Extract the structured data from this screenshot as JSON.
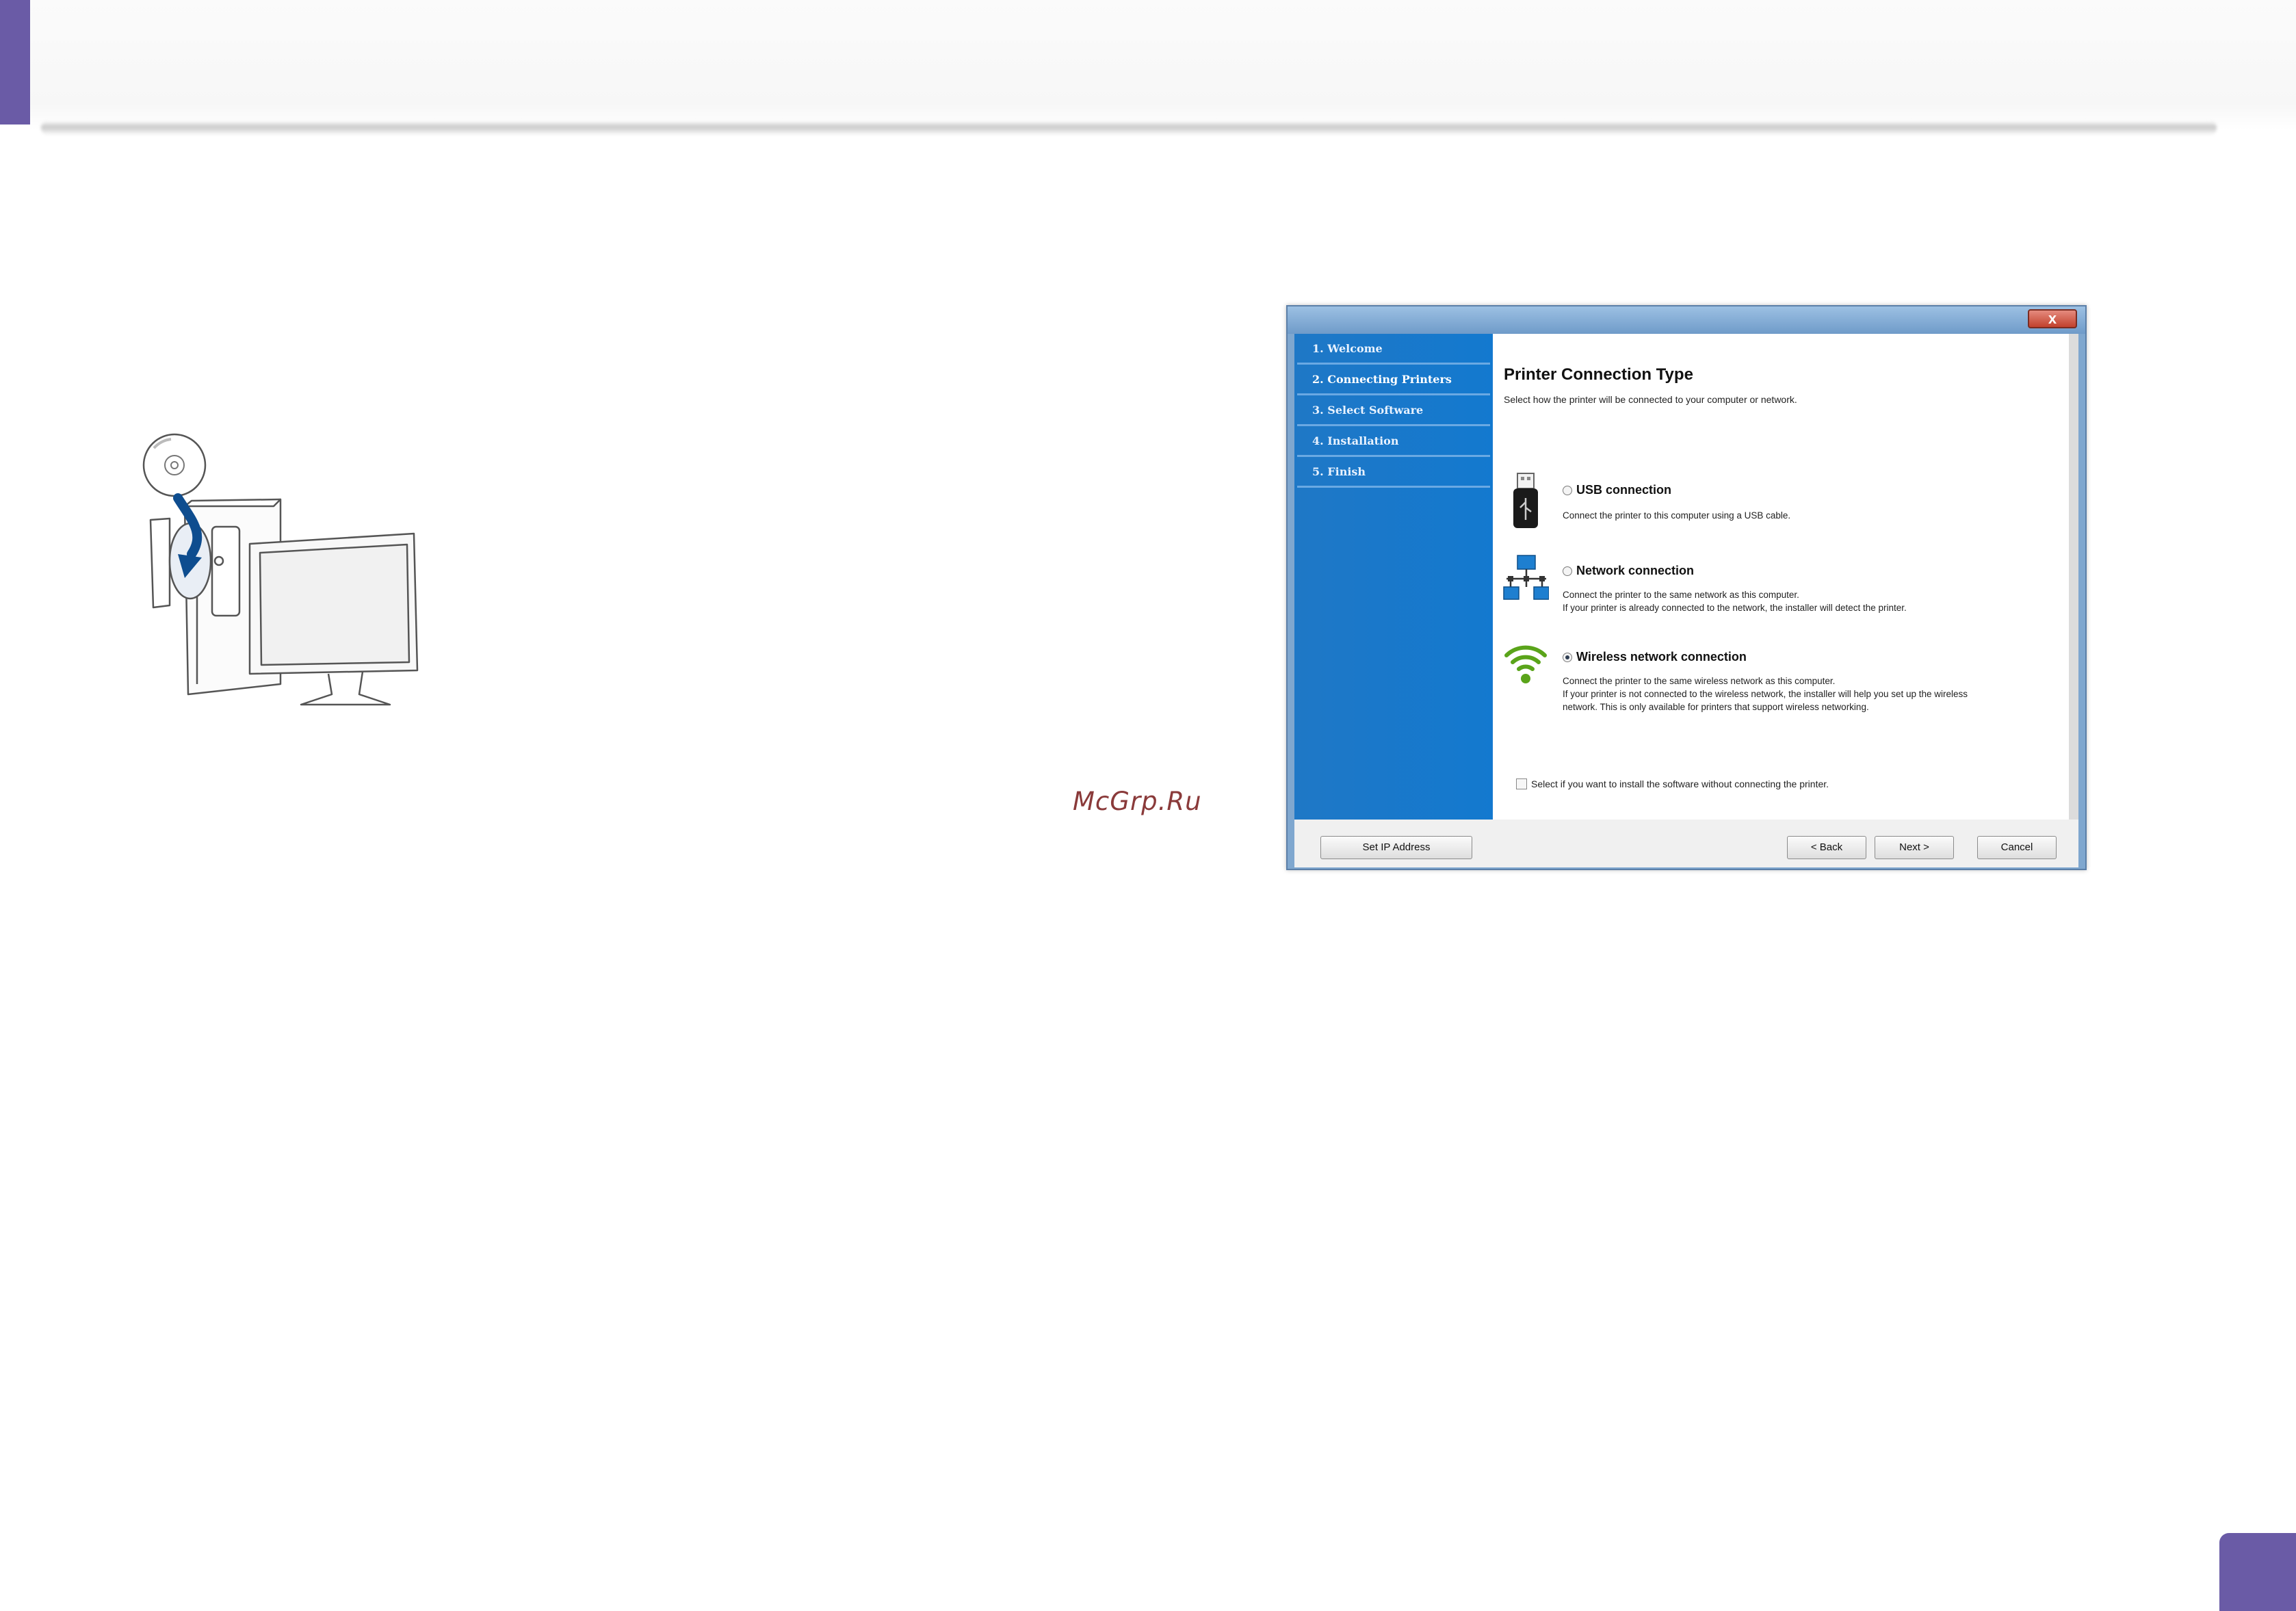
{
  "watermark": "McGrp.Ru",
  "dialog": {
    "close_label": "x",
    "steps": [
      {
        "label": "1. Welcome"
      },
      {
        "label": "2. Connecting Printers"
      },
      {
        "label": "3. Select Software"
      },
      {
        "label": "4. Installation"
      },
      {
        "label": "5. Finish"
      }
    ],
    "title": "Printer Connection Type",
    "subtitle": "Select how the printer will be connected to your computer or network.",
    "options": {
      "usb": {
        "label": "USB connection",
        "desc1": "Connect the printer to this computer using a USB cable.",
        "selected": false,
        "icon": "usb-icon"
      },
      "network": {
        "label": "Network connection",
        "desc1": "Connect the printer to the same network as this computer.",
        "desc2": "If your printer is already connected to the network, the installer will detect the printer.",
        "selected": false,
        "icon": "network-icon"
      },
      "wireless": {
        "label": "Wireless network connection",
        "desc1": "Connect the printer to the same wireless network as this computer.",
        "desc2": "If your printer is not connected to the wireless network, the installer will help you set up the wireless",
        "desc3": "network. This is only available for printers that support wireless networking.",
        "selected": true,
        "icon": "wifi-icon"
      }
    },
    "checkbox_label": "Select if you want to install the software without connecting the printer.",
    "checkbox_checked": false,
    "buttons": {
      "set_ip": "Set IP Address",
      "back": "< Back",
      "next": "Next >",
      "cancel": "Cancel"
    }
  },
  "colors": {
    "accent": "#6a5ba6",
    "sidebar_blue": "#1379cf",
    "wifi_green": "#5aa41a"
  }
}
